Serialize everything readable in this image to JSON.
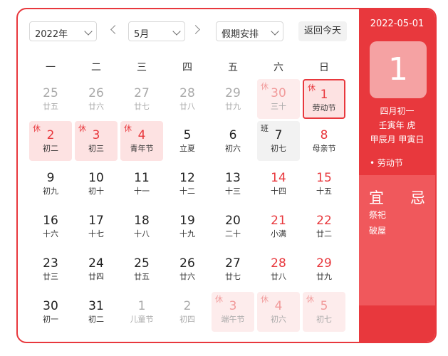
{
  "toolbar": {
    "year": "2022年",
    "month": "5月",
    "holiday_select": "假期安排",
    "today_button": "返回今天"
  },
  "weekdays": [
    "一",
    "二",
    "三",
    "四",
    "五",
    "六",
    "日"
  ],
  "days": [
    {
      "num": "25",
      "lunar": "廿五",
      "badge": "",
      "type": "other"
    },
    {
      "num": "26",
      "lunar": "廿六",
      "badge": "",
      "type": "other"
    },
    {
      "num": "27",
      "lunar": "廿七",
      "badge": "",
      "type": "other"
    },
    {
      "num": "28",
      "lunar": "廿八",
      "badge": "",
      "type": "other"
    },
    {
      "num": "29",
      "lunar": "廿九",
      "badge": "",
      "type": "other"
    },
    {
      "num": "30",
      "lunar": "三十",
      "badge": "休",
      "type": "holiday other"
    },
    {
      "num": "1",
      "lunar": "劳动节",
      "badge": "休",
      "type": "holiday selected festival"
    },
    {
      "num": "2",
      "lunar": "初二",
      "badge": "休",
      "type": "holiday"
    },
    {
      "num": "3",
      "lunar": "初三",
      "badge": "休",
      "type": "holiday"
    },
    {
      "num": "4",
      "lunar": "青年节",
      "badge": "休",
      "type": "holiday festival"
    },
    {
      "num": "5",
      "lunar": "立夏",
      "badge": "",
      "type": ""
    },
    {
      "num": "6",
      "lunar": "初六",
      "badge": "",
      "type": ""
    },
    {
      "num": "7",
      "lunar": "初七",
      "badge": "班",
      "type": "workday"
    },
    {
      "num": "8",
      "lunar": "母亲节",
      "badge": "",
      "type": "weekend"
    },
    {
      "num": "9",
      "lunar": "初九",
      "badge": "",
      "type": ""
    },
    {
      "num": "10",
      "lunar": "初十",
      "badge": "",
      "type": ""
    },
    {
      "num": "11",
      "lunar": "十一",
      "badge": "",
      "type": ""
    },
    {
      "num": "12",
      "lunar": "十二",
      "badge": "",
      "type": ""
    },
    {
      "num": "13",
      "lunar": "十三",
      "badge": "",
      "type": ""
    },
    {
      "num": "14",
      "lunar": "十四",
      "badge": "",
      "type": "weekend"
    },
    {
      "num": "15",
      "lunar": "十五",
      "badge": "",
      "type": "weekend"
    },
    {
      "num": "16",
      "lunar": "十六",
      "badge": "",
      "type": ""
    },
    {
      "num": "17",
      "lunar": "十七",
      "badge": "",
      "type": ""
    },
    {
      "num": "18",
      "lunar": "十八",
      "badge": "",
      "type": ""
    },
    {
      "num": "19",
      "lunar": "十九",
      "badge": "",
      "type": ""
    },
    {
      "num": "20",
      "lunar": "二十",
      "badge": "",
      "type": ""
    },
    {
      "num": "21",
      "lunar": "小满",
      "badge": "",
      "type": "weekend"
    },
    {
      "num": "22",
      "lunar": "廿二",
      "badge": "",
      "type": "weekend"
    },
    {
      "num": "23",
      "lunar": "廿三",
      "badge": "",
      "type": ""
    },
    {
      "num": "24",
      "lunar": "廿四",
      "badge": "",
      "type": ""
    },
    {
      "num": "25",
      "lunar": "廿五",
      "badge": "",
      "type": ""
    },
    {
      "num": "26",
      "lunar": "廿六",
      "badge": "",
      "type": ""
    },
    {
      "num": "27",
      "lunar": "廿七",
      "badge": "",
      "type": ""
    },
    {
      "num": "28",
      "lunar": "廿八",
      "badge": "",
      "type": "weekend"
    },
    {
      "num": "29",
      "lunar": "廿九",
      "badge": "",
      "type": "weekend"
    },
    {
      "num": "30",
      "lunar": "初一",
      "badge": "",
      "type": ""
    },
    {
      "num": "31",
      "lunar": "初二",
      "badge": "",
      "type": ""
    },
    {
      "num": "1",
      "lunar": "儿童节",
      "badge": "",
      "type": "other"
    },
    {
      "num": "2",
      "lunar": "初四",
      "badge": "",
      "type": "other"
    },
    {
      "num": "3",
      "lunar": "端午节",
      "badge": "休",
      "type": "holiday other"
    },
    {
      "num": "4",
      "lunar": "初六",
      "badge": "休",
      "type": "holiday other"
    },
    {
      "num": "5",
      "lunar": "初七",
      "badge": "休",
      "type": "holiday other"
    }
  ],
  "side": {
    "date": "2022-05-01",
    "day": "1",
    "lunar_date": "四月初一",
    "ganzhi_year": "壬寅年 虎",
    "ganzhi_month_day": "甲辰月 甲寅日",
    "festival": "• 劳动节",
    "yi_label": "宜",
    "ji_label": "忌",
    "yi_items": [
      "祭祀",
      "破屋"
    ]
  },
  "colors": {
    "accent": "#e8383d",
    "holiday_bg": "#fde2e2",
    "workday_bg": "#f2f2f2"
  }
}
